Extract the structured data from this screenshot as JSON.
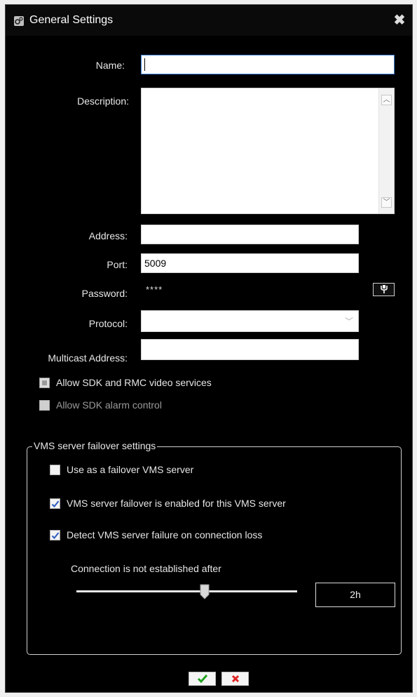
{
  "window": {
    "title": "General Settings"
  },
  "form": {
    "name_label": "Name:",
    "name_value": "",
    "description_label": "Description:",
    "description_value": "",
    "address_label": "Address:",
    "address_value": "",
    "port_label": "Port:",
    "port_value": "5009",
    "password_label": "Password:",
    "password_value": "****",
    "protocol_label": "Protocol:",
    "protocol_value": "",
    "multicast_label": "Multicast Address:",
    "multicast_value": ""
  },
  "options": {
    "allow_sdk_rmc_label": "Allow SDK and RMC video services",
    "allow_sdk_rmc_state": "indeterminate",
    "allow_sdk_alarm_label": "Allow SDK alarm control",
    "allow_sdk_alarm_state": "unchecked-disabled"
  },
  "failover": {
    "group_label": "VMS server failover settings",
    "use_failover_label": "Use as a failover VMS server",
    "use_failover_checked": false,
    "enabled_label": "VMS server failover is enabled for this VMS server",
    "enabled_checked": true,
    "detect_label": "Detect VMS server failure on connection loss",
    "detect_checked": true,
    "connection_label": "Connection is not established after",
    "slider_level_fraction": 0.58,
    "time_value": "2h"
  },
  "icons": {
    "app": "gear-icon",
    "close": "close-icon",
    "password_button": "key-icon",
    "ok": "checkmark-icon",
    "cancel": "cross-icon"
  },
  "colors": {
    "background": "#000000",
    "focus_border": "#3c7fd6",
    "ok_green": "#22a322",
    "cancel_red": "#e02424",
    "check_blue": "#2a5bbf"
  }
}
